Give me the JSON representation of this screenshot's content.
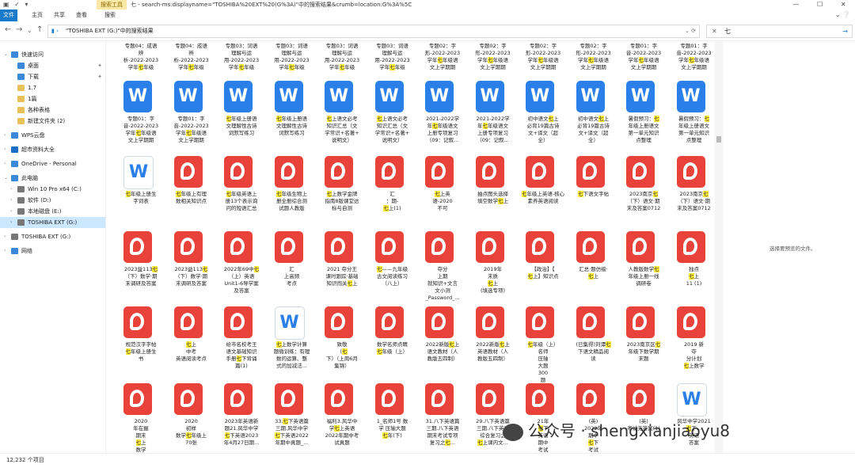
{
  "window": {
    "title": "七 - search-ms:displayname=\"TOSHIBA%20EXT%20(G%3A)\"中的搜索结果&crumb=location:G%3A%5C",
    "search_tools_label": "搜索工具",
    "minimize": "—",
    "maximize": "☐",
    "close": "✕"
  },
  "ribbon": {
    "tabs": [
      "文件",
      "主页",
      "共享",
      "查看",
      "搜索"
    ]
  },
  "address": {
    "path": "\"TOSHIBA EXT (G:)\"中的搜索结果",
    "search_value": "七",
    "back": "←",
    "forward": "→",
    "down": "⌄",
    "up": "↑"
  },
  "sidebar": {
    "items": [
      {
        "label": "快速访问",
        "color": "#3b8ad9",
        "pin": false
      },
      {
        "label": "桌面",
        "color": "#3b8ad9",
        "pin": true
      },
      {
        "label": "下载",
        "color": "#3b8ad9",
        "pin": true
      },
      {
        "label": "1.7",
        "color": "#e8c15a",
        "pin": false
      },
      {
        "label": "1篇",
        "color": "#e8c15a",
        "pin": false
      },
      {
        "label": "各种表格",
        "color": "#e8c15a",
        "pin": false
      },
      {
        "label": "新建文件夹 (2)",
        "color": "#e8c15a",
        "pin": false
      },
      {
        "label": "WPS云盘",
        "color": "#3b8ad9",
        "pin": false
      },
      {
        "label": "超市资料大全",
        "color": "#1a6ec7",
        "pin": false
      },
      {
        "label": "OneDrive - Personal",
        "color": "#3b8ad9",
        "pin": false
      },
      {
        "label": "此电脑",
        "color": "#3b8ad9",
        "pin": false
      },
      {
        "label": "Win 10 Pro x64 (C:)",
        "color": "#777",
        "pin": false
      },
      {
        "label": "软件 (D:)",
        "color": "#777",
        "pin": false
      },
      {
        "label": "本地磁盘 (E:)",
        "color": "#777",
        "pin": false
      },
      {
        "label": "TOSHIBA EXT (G:)",
        "color": "#777",
        "pin": false
      },
      {
        "label": "TOSHIBA EXT (G:)",
        "color": "#777",
        "pin": false
      },
      {
        "label": "网络",
        "color": "#3b8ad9",
        "pin": false
      }
    ]
  },
  "preview": {
    "message": "选择要预览的文件。"
  },
  "status": {
    "count": "12,232 个项目"
  },
  "watermark": {
    "text": "公众号 · shengxianjiaoyu8"
  },
  "files": {
    "row0": [
      [
        "专题04：成语",
        "辨",
        "析-2022-2023",
        "学年七年级"
      ],
      [
        "专题04：成语",
        "辨",
        "析-2022-2023",
        "学年七年级"
      ],
      [
        "专题03：词语",
        "理解与运",
        "用-2022-2023",
        "学年七年级"
      ],
      [
        "专题03：词语",
        "理解与运",
        "用-2022-2023",
        "学年七年级"
      ],
      [
        "专题03：词语",
        "理解与运",
        "用-2022-2023",
        "学年七年级"
      ],
      [
        "专题03：词语",
        "理解与运",
        "用-2022-2023",
        "学年七年级"
      ],
      [
        "专题02：字",
        "形-2022-2023",
        "学年七年级语",
        "文上学期期"
      ],
      [
        "专题02：字",
        "形-2022-2023",
        "学年七年级语",
        "文上学期期"
      ],
      [
        "专题02：字",
        "形-2022-2023",
        "学年七年级语",
        "文上学期期"
      ],
      [
        "专题02：字",
        "形-2022-2023",
        "学年七年级语",
        "文上学期期"
      ],
      [
        "专题01：字",
        "音-2022-2023",
        "学年七年级语",
        "文上学期期"
      ],
      [
        "专题01：字",
        "音-2022-2023",
        "学年七年级语",
        "文上学期期"
      ]
    ],
    "row1": [
      [
        "专题01：字",
        "音-2022-2023",
        "学年七年级语",
        "文上学期期"
      ],
      [
        "专题01：字",
        "音-2022-2023",
        "学年七年级语",
        "文上学期期"
      ],
      [
        "七年级上册语",
        "文理解性古诗",
        "词默写练习"
      ],
      [
        "七年级上册语",
        "文理解性古诗",
        "词默写练习"
      ],
      [
        "七上语文必考",
        "知识汇总（文",
        "学常识+名著+",
        "说明文）"
      ],
      [
        "七上语文必考",
        "知识汇总（文",
        "学常识+名著+",
        "说明文）"
      ],
      [
        "2021-2022学",
        "年七年级语文",
        "上册专项复习",
        "（09：记叙..."
      ],
      [
        "2021-2022学",
        "年七年级语文",
        "上册专项复习",
        "（09：记叙..."
      ],
      [
        "初中语文七上",
        "必背19篇古诗",
        "文+译文（超",
        "全）"
      ],
      [
        "初中语文七上",
        "必背19篇古诗",
        "文+译文（超",
        "全）"
      ],
      [
        "暑假预习：七",
        "年级上册语文",
        "第一单元知识",
        "点整理"
      ],
      [
        "暑假预习：七",
        "年级上册语文",
        "第一单元知识",
        "点整理"
      ]
    ],
    "row2": [
      [
        "七年级上册生",
        "字词表"
      ],
      [
        "七年级上有理",
        "数相关知识点"
      ],
      [
        "七年级英语上",
        "册13个表示询",
        "问的短语汇总"
      ],
      [
        "七年级生物上",
        "册全册综合测",
        "试题人教版"
      ],
      [
        "七上数学金牌",
        "指南8版课堂达",
        "标与自测"
      ],
      [
        "汇",
        "：期-",
        "七上(1)"
      ],
      [
        "七上英",
        "语-2020",
        "不可"
      ],
      [
        "抽点图头选择",
        "填空数学七上"
      ],
      [
        "七年级上英语-核心",
        "素养英语阅读"
      ],
      [
        "七下语文字帖"
      ],
      [
        "2023南京七",
        "（下）语文·期",
        "末及答案0712"
      ],
      [
        "2023南京七",
        "（下）语文·期",
        "末及答案0712"
      ]
    ],
    "row3": [
      [
        "2023益113七",
        "（下）数学·期",
        "末调研及答案"
      ],
      [
        "2023益113七",
        "（下）数学·期",
        "末调研及答案"
      ],
      [
        "2022年69中七",
        "（上）英语",
        "Unit1-6导学案",
        "及答案"
      ],
      [
        "汇",
        "上高频",
        "考点"
      ],
      [
        "2021 夺分王",
        "课时跟踪·基础",
        "知识闯关七上"
      ],
      [
        "七——九年级",
        "古文阅读练习",
        "（八上）"
      ],
      [
        "夺分",
        "上期",
        "就知识+文言",
        "文小测",
        "_Password_..."
      ],
      [
        "2019年",
        "末质",
        "七上",
        "(填选专项)"
      ],
      [
        "【政治】【",
        "七上】知识点"
      ],
      [
        "汇总·题仿级·",
        "七上"
      ],
      [
        "人教版数学七",
        "年级上册一线",
        "调研卷"
      ],
      [
        "独点",
        "七上",
        "11 (1)"
      ]
    ],
    "row4": [
      [
        "规范汉字字帖",
        "七年级上册生",
        "书"
      ],
      [
        "七上",
        "中考",
        "英语阅读考点"
      ],
      [
        "给市名校考王",
        "语文基础知识",
        "手册七下背诵",
        "篇(1)"
      ],
      [
        "七上数学计算",
        "题微训练：有理",
        "数的运算、整",
        "式的加减法..."
      ],
      [
        "致敬",
        "（七",
        "下）（上周6月",
        "集锦）"
      ],
      [
        "数学名师点睛",
        "七年级（上）"
      ],
      [
        "2022新版七上",
        "语文教材（人",
        "教版五四制）"
      ],
      [
        "2022新版七上",
        "英语教材（人",
        "教版五四制）"
      ],
      [
        "七年级（上）",
        "名师",
        "压轴",
        "大题",
        "300",
        "题"
      ],
      [
        "(已集得)刘谭七",
        "下语文精品阅",
        "读"
      ],
      [
        "2023南京区七",
        "年级下数学期",
        "末题"
      ],
      [
        "2019 新",
        "夺",
        "分计划",
        "七上数学"
      ]
    ],
    "row5": [
      [
        "2020",
        "年在握",
        "期末",
        "七上",
        "数学"
      ],
      [
        "2020",
        "初样",
        "数学七年级上",
        "70张"
      ],
      [
        "2023年英语新",
        "题21.风华中学",
        "七下英语2023",
        "年4月27日期..."
      ],
      [
        "33.七下英语篇",
        "三期.风华中学",
        "七下英语2022",
        "年期中真题_..."
      ],
      [
        "福利3.风华中",
        "学七上英语",
        "2022年期中考",
        "试真题"
      ],
      [
        "1_名师1号 数",
        "学 压轴大题",
        "七年(下)"
      ],
      [
        "31.八下英语篇",
        "三期.八下英语",
        "期末考试专项",
        "复习之七..."
      ],
      [
        "29.八下英语篇",
        "三期.八下英语",
        "综合复习之",
        "七上课内文..."
      ],
      [
        "21年",
        "七下",
        "英语",
        "期中",
        "考试"
      ],
      [
        "(英)",
        "2022年",
        "期中",
        "七下",
        "考试"
      ],
      [
        "(英)",
        "考试无答案(1)"
      ],
      [
        "风华中学2021",
        "七下...",
        "英语",
        "答案"
      ]
    ]
  }
}
